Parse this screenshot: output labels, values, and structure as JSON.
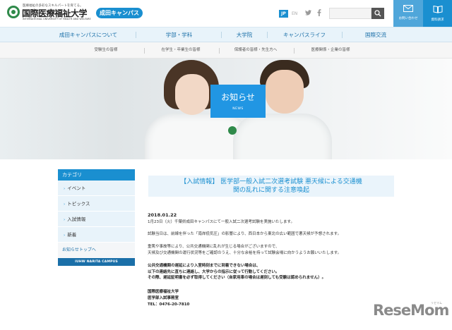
{
  "header": {
    "tagline": "医療福祉の多彩なスキルパートを育てる。",
    "university_name": "国際医療福祉大学",
    "university_name_en": "INTERNATIONAL UNIVERSITY OF HEALTH AND WELFARE",
    "campus_label": "成田キャンパス",
    "lang_jp": "JP",
    "lang_en": "EN",
    "search_placeholder": "",
    "contact_label": "お問い合わせ",
    "document_request_label": "資料請求"
  },
  "main_nav": {
    "items": [
      {
        "label": "成田キャンパスについて"
      },
      {
        "label": "学部・学科"
      },
      {
        "label": "大学院"
      },
      {
        "label": "キャンパスライフ"
      },
      {
        "label": "国際交流"
      }
    ]
  },
  "sub_nav": {
    "items": [
      {
        "label": "受験生の皆様"
      },
      {
        "label": "在学生・卒業生の皆様"
      },
      {
        "label": "保護者の皆様・先生方へ"
      },
      {
        "label": "医療関係・企業の皆様"
      }
    ]
  },
  "hero": {
    "title": "お知らせ",
    "subtitle": "NEWS"
  },
  "sidebar": {
    "heading": "カテゴリ",
    "items": [
      {
        "label": "イベント"
      },
      {
        "label": "トピックス"
      },
      {
        "label": "入試情報"
      },
      {
        "label": "新着"
      }
    ],
    "top_link": "お知らせトップへ",
    "campus_banner": "IUHW NARITA CAMPUS"
  },
  "article": {
    "title_line1": "【入試情報】 医学部一般入試二次選考試験 悪天候による交通機",
    "title_line2": "関の乱れに関する注意喚起",
    "date": "2018.01.22",
    "paragraphs": [
      [
        "1月23日（火）千葉県成田キャンパスにて一般入試二次選考試験を実施いたします。"
      ],
      [
        "試験当日は、前線を伴った「南岸低気圧」の影響により、西日本から東北の広い範囲で悪天候が予想されます。"
      ],
      [
        "重篤や事故等により、公共交通機関に乱れが生じる場合がございますので、",
        "天候及び交通機関の運行状況等をご確認のうえ、十分な余裕を持って試験会場に向かうようお願いいたします。"
      ],
      [
        "公共交通機関の遅延により入室時刻までに到着できない場合は、",
        "以下の連絡先に直ちに連絡し、大学からの指示に従って行動してください。",
        "その際、遅延証明書を必ず取得してください（自家用車の場合は遅刻しても受験は認められません）。"
      ],
      [
        "国際医療福祉大学",
        "医学部入試事務室",
        "TEL：0476-20-7810"
      ]
    ]
  },
  "watermark": {
    "logo": "ReseMom",
    "sub": "リセマム"
  }
}
